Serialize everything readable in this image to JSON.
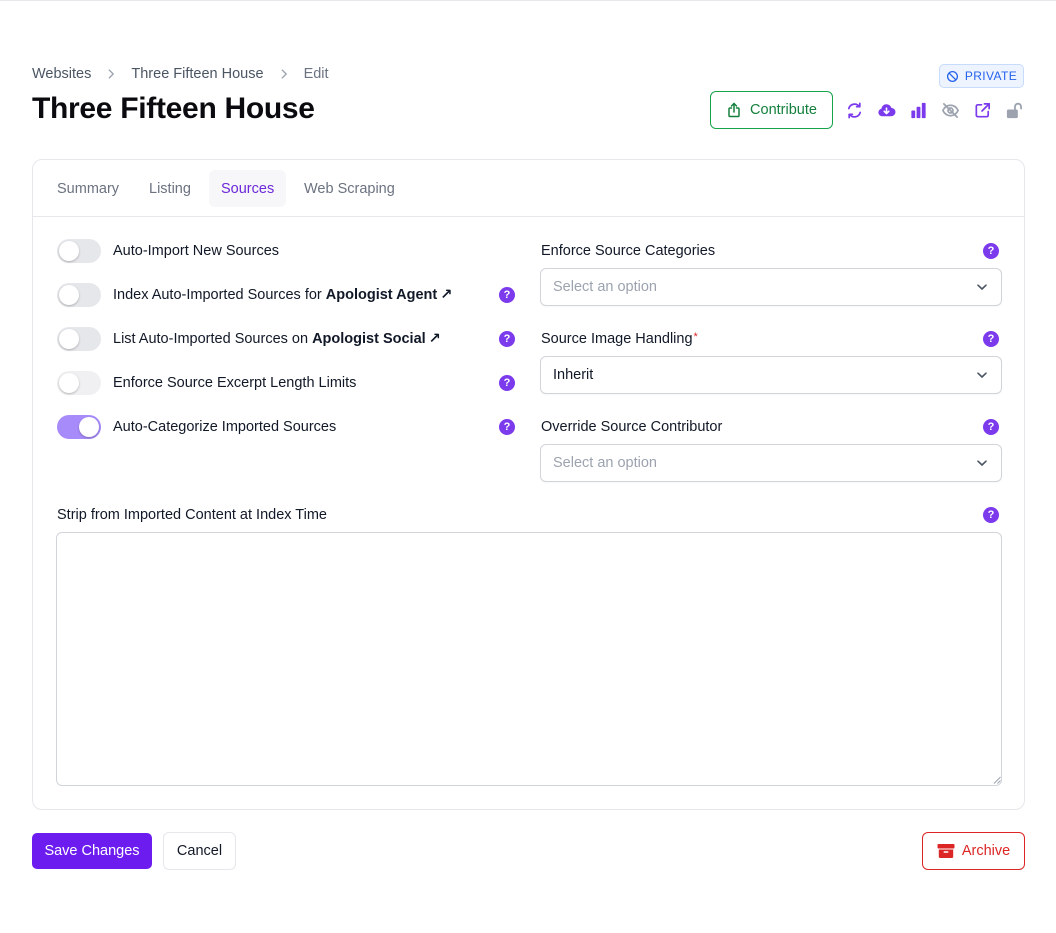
{
  "breadcrumb": {
    "items": [
      "Websites",
      "Three Fifteen House",
      "Edit"
    ]
  },
  "page": {
    "title": "Three Fifteen House"
  },
  "badge": {
    "label": "PRIVATE"
  },
  "header_actions": {
    "contribute_label": "Contribute",
    "icons": [
      "refresh-icon",
      "cloud-download-icon",
      "bar-chart-icon",
      "eye-slash-icon",
      "external-link-icon",
      "lock-open-icon"
    ]
  },
  "colors": {
    "accent": "#6d28d9",
    "primary_button": "#6d1cf0",
    "success": "#15803d",
    "danger": "#dc2626",
    "info": "#2563eb"
  },
  "tabs": [
    {
      "label": "Summary",
      "active": false
    },
    {
      "label": "Listing",
      "active": false
    },
    {
      "label": "Sources",
      "active": true
    },
    {
      "label": "Web Scraping",
      "active": false
    }
  ],
  "toggles": {
    "auto_import": {
      "label": "Auto-Import New Sources",
      "on": false
    },
    "index_auto": {
      "label_prefix": "Index Auto-Imported Sources for ",
      "label_bold": "Apologist Agent",
      "arrow": "↗",
      "on": false
    },
    "list_auto": {
      "label_prefix": "List Auto-Imported Sources on ",
      "label_bold": "Apologist Social",
      "arrow": "↗",
      "on": false
    },
    "enforce_excerpt": {
      "label": "Enforce Source Excerpt Length Limits",
      "on": false,
      "disabled": true
    },
    "auto_categorize": {
      "label": "Auto-Categorize Imported Sources",
      "on": true
    }
  },
  "fields": {
    "enforce_categories": {
      "label": "Enforce Source Categories",
      "placeholder": "Select an option"
    },
    "image_handling": {
      "label": "Source Image Handling",
      "required_mark": "*",
      "value": "Inherit"
    },
    "override_contributor": {
      "label": "Override Source Contributor",
      "placeholder": "Select an option"
    },
    "strip_content": {
      "label": "Strip from Imported Content at Index Time",
      "value": ""
    }
  },
  "help_glyph": "?",
  "footer": {
    "save_label": "Save Changes",
    "cancel_label": "Cancel",
    "archive_label": "Archive"
  }
}
